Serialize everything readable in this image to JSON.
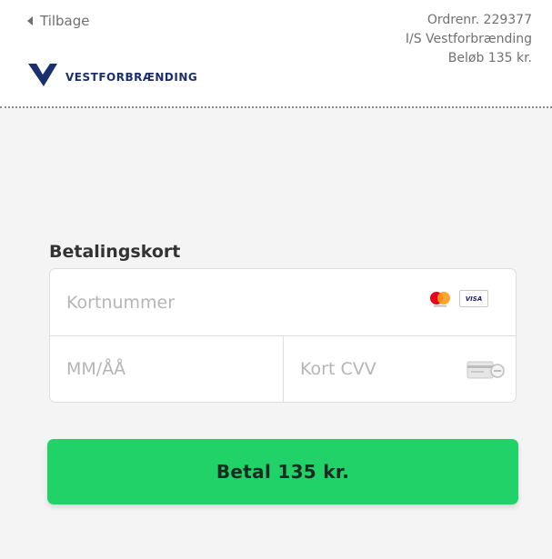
{
  "header": {
    "back_label": "Tilbage",
    "order_number": "Ordrenr. 229377",
    "merchant": "I/S Vestforbrænding",
    "amount": "Beløb 135 kr.",
    "logo_text": "VESTFORBRÆNDING"
  },
  "payment": {
    "section_label": "Betalingskort",
    "card_number_placeholder": "Kortnummer",
    "expiry_placeholder": "MM/ÅÅ",
    "cvv_placeholder": "Kort CVV",
    "brand_icons": [
      "mastercard-icon",
      "visa-icon"
    ],
    "visa_text": "VISA",
    "pay_label": "Betal 135 kr."
  },
  "colors": {
    "accent": "#20d267",
    "logo_blue": "#1a2f6e",
    "background": "#f4f4f4"
  }
}
